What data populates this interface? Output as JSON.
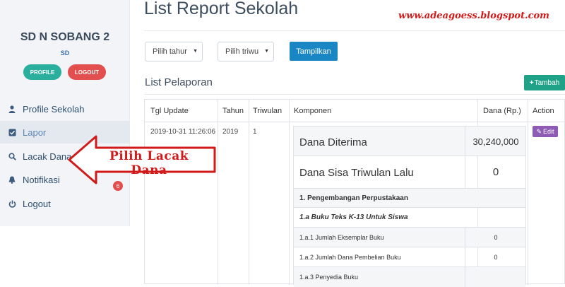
{
  "sidebar": {
    "school_name": "SD N SOBANG 2",
    "school_level": "SD",
    "profile_button": "PROFILE",
    "logout_button": "LOGOUT",
    "items": [
      {
        "label": "Profile Sekolah",
        "icon": "user-icon"
      },
      {
        "label": "Lapor",
        "icon": "check-square-icon",
        "active": true
      },
      {
        "label": "Lacak Dana",
        "icon": "search-icon"
      },
      {
        "label": "Notifikasi",
        "icon": "bell-icon",
        "badge": "6"
      },
      {
        "label": "Logout",
        "icon": "power-icon"
      }
    ]
  },
  "annotation": {
    "text": "Pilih Lacak Dana",
    "watermark": "www.adeagoess.blogspot.com",
    "color": "#d11a1a"
  },
  "header": {
    "title": "List Report Sekolah"
  },
  "filters": {
    "year_select": "Pilih tahur",
    "quarter_select": "Pilih triwu",
    "show_button": "Tampilkan"
  },
  "list": {
    "title": "List Pelaporan",
    "add_button": "Tambah"
  },
  "table": {
    "columns": [
      "Tgl Update",
      "Tahun",
      "Triwulan",
      "Komponen",
      "Dana (Rp.)",
      "Action"
    ],
    "row": {
      "date": "2019-10-31 11:26:06",
      "year": "2019",
      "quarter": "1",
      "edit_button": "Edit"
    },
    "components": [
      {
        "label": "Dana Diterima",
        "value": "30,240,000"
      },
      {
        "label": "Dana Sisa Triwulan Lalu",
        "value": "0"
      },
      {
        "label": "1. Pengembangan Perpustakaan",
        "value": ""
      },
      {
        "label": "1.a Buku Teks K-13 Untuk Siswa",
        "value": ""
      },
      {
        "label": "1.a.1 Jumlah Eksemplar Buku",
        "value": "0"
      },
      {
        "label": "1.a.2 Jumlah Dana Pembelian Buku",
        "value": "0"
      },
      {
        "label": "1.a.3 Penyedia Buku",
        "value": ""
      }
    ]
  },
  "colors": {
    "profile": "#2aae9e",
    "logout": "#e34e4e",
    "primary": "#1a87c4",
    "success": "#1fa287",
    "edit": "#8e5bb5"
  }
}
